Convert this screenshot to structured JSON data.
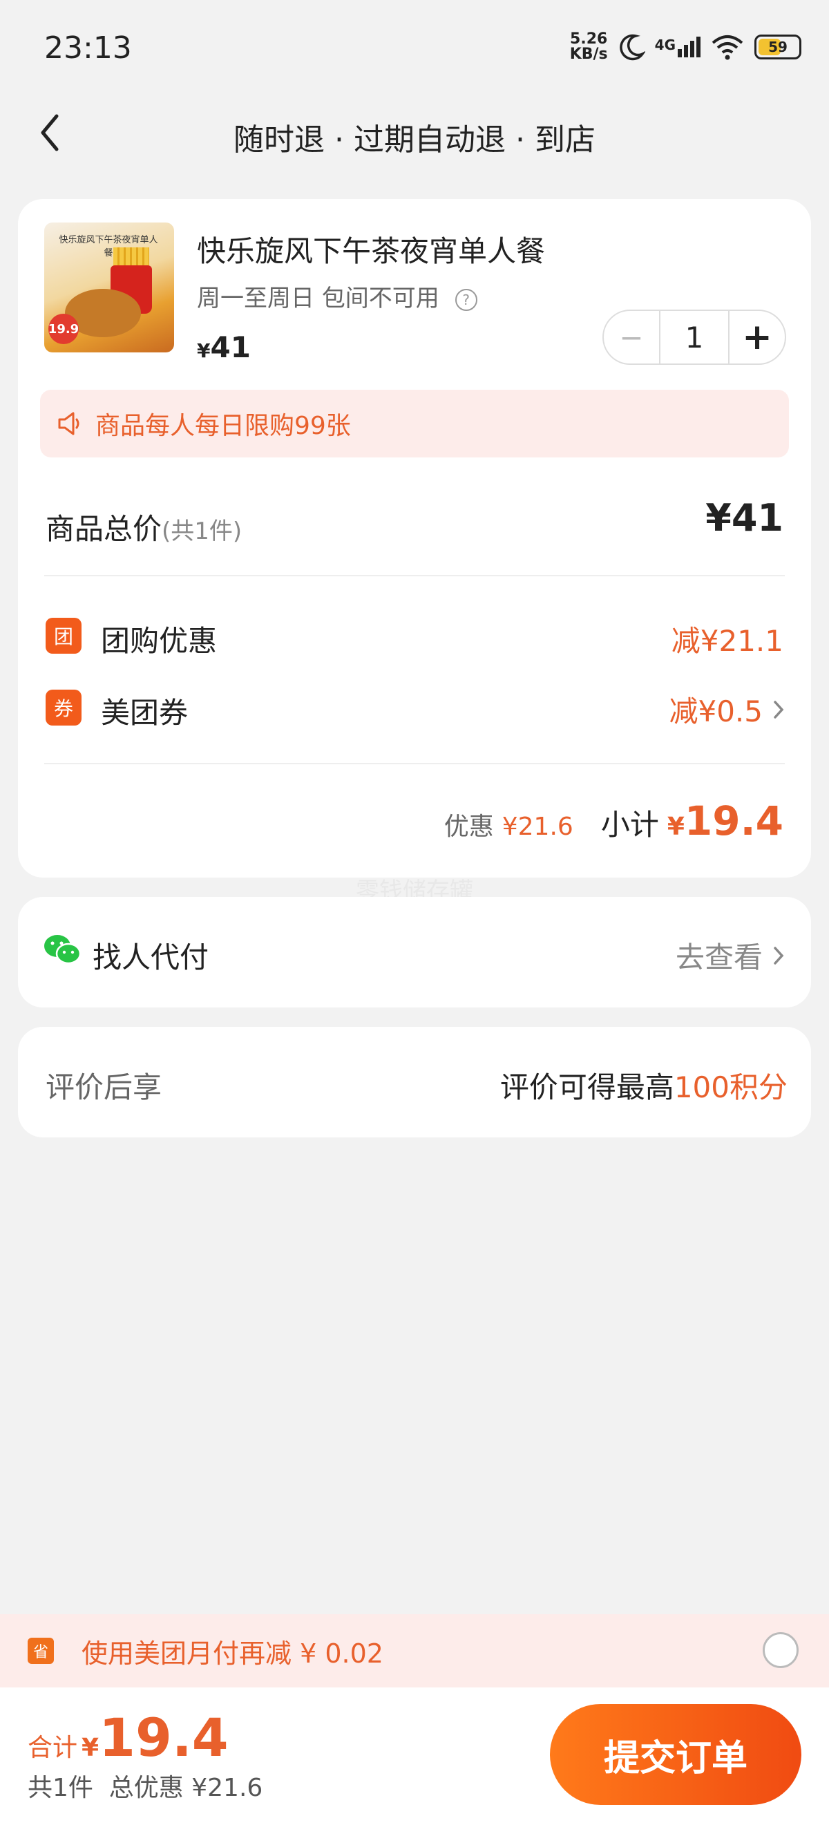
{
  "status_bar": {
    "time": "23:13",
    "net_speed_value": "5.26",
    "net_speed_unit": "KB/s",
    "network": "4G",
    "battery": "59"
  },
  "header": {
    "title": "随时退 · 过期自动退 · 到店"
  },
  "product": {
    "image_caption": "快乐旋风下午茶夜宵单人餐",
    "image_price_badge": "19.9",
    "name": "快乐旋风下午茶夜宵单人餐",
    "subtitle": "周一至周日 包间不可用",
    "help_icon_glyph": "?",
    "currency": "¥",
    "price": "41",
    "quantity": "1",
    "minus_glyph": "−",
    "plus_glyph": "+"
  },
  "notice": {
    "text": "商品每人每日限购99张"
  },
  "totals": {
    "goods_total_label": "商品总价",
    "goods_count": "(共1件)",
    "goods_total_value": "¥41",
    "discount_rows": [
      {
        "tag": "团",
        "label": "团购优惠",
        "value": "减¥21.1"
      },
      {
        "tag": "券",
        "label": "美团券",
        "value": "减¥0.5"
      }
    ],
    "discount_label": "优惠",
    "discount_value": "¥21.6",
    "subtotal_label": "小计",
    "subtotal_currency": "¥",
    "subtotal_value": "19.4"
  },
  "watermark": "零钱储存罐",
  "pay_for_me": {
    "label": "找人代付",
    "action": "去查看"
  },
  "review": {
    "label": "评价后享",
    "text": "评价可得最高",
    "points": "100积分"
  },
  "promo": {
    "icon_glyph": "省",
    "text": "使用美团月付再减 ¥ 0.02"
  },
  "footer": {
    "total_label": "合计",
    "currency": "¥",
    "total_value": "19.4",
    "summary": "共1件  总优惠 ¥21.6",
    "submit_label": "提交订单"
  },
  "colors": {
    "accent": "#f04b12",
    "promo_bg": "#fdecea",
    "wechat_green": "#28c445"
  }
}
